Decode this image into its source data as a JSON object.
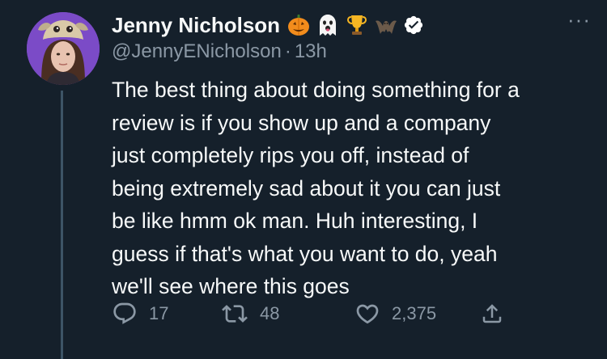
{
  "author": {
    "display_name": "Jenny Nicholson",
    "handle": "@JennyENicholson",
    "separator": "·",
    "time": "13h",
    "badges": [
      "jack-o-lantern-emoji",
      "ghost-emoji",
      "trophy-emoji",
      "bat-emoji",
      "verified-badge-icon"
    ]
  },
  "tweet": {
    "text": "The best thing about doing something for a\nreview is if you show up and a company\njust completely rips you off, instead of\nbeing extremely sad about it you can just\nbe like hmm ok man. Huh interesting, I\nguess if that's what you want to do, yeah\nwe'll see where this goes"
  },
  "actions": {
    "replies": "17",
    "retweets": "48",
    "likes": "2,375"
  },
  "menu": {
    "more_label": "···"
  },
  "colors": {
    "background": "#15202b",
    "text_primary": "#f7f9f9",
    "text_secondary": "#8b98a5",
    "thread_line": "#3d5466",
    "verified": "#ffffff"
  }
}
